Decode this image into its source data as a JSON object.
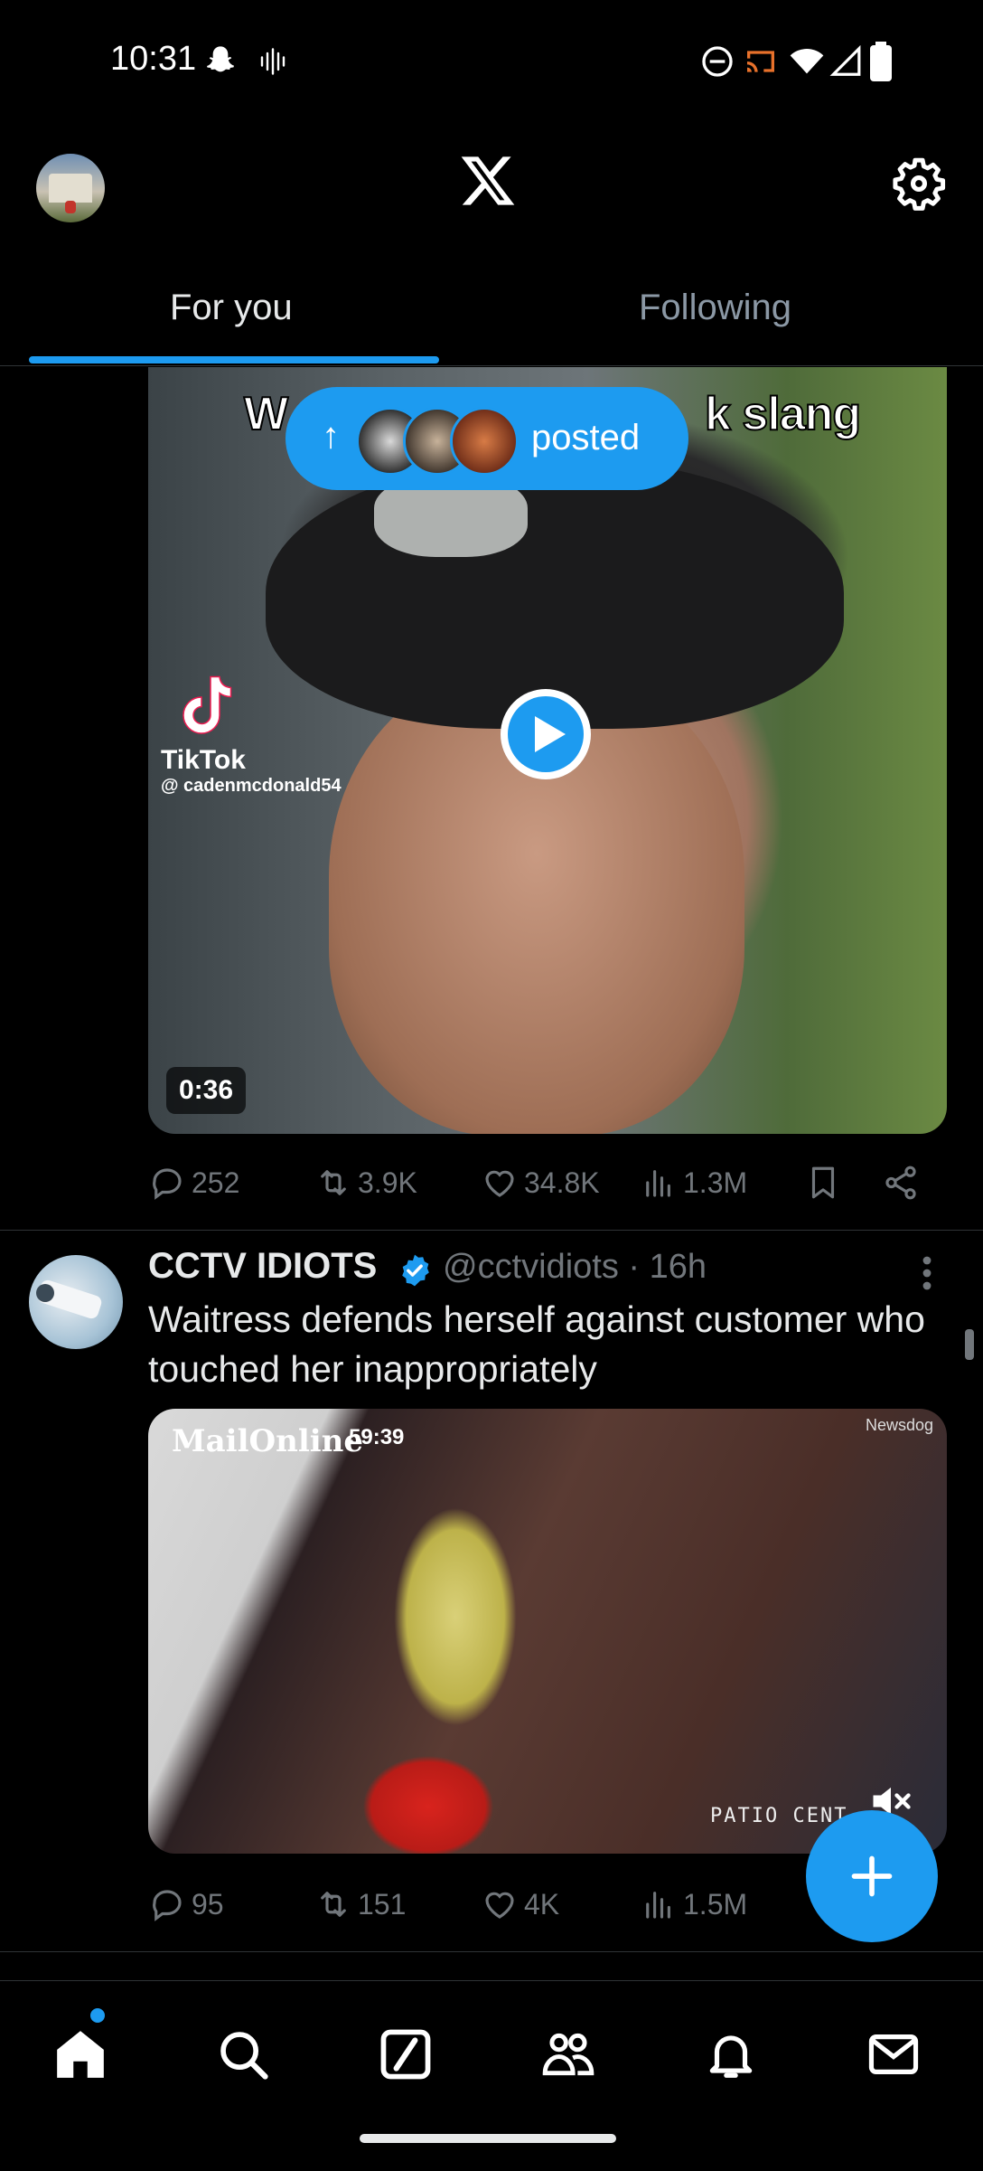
{
  "status_bar": {
    "time": "10:31",
    "icons": [
      "snapchat-icon",
      "voicemail-icon",
      "dnd-icon",
      "cast-icon",
      "wifi-icon",
      "signal-icon",
      "battery-icon"
    ]
  },
  "header": {
    "logo": "x-logo-icon",
    "settings": "gear-icon"
  },
  "tabs": [
    {
      "label": "For you",
      "active": true
    },
    {
      "label": "Following",
      "active": false
    }
  ],
  "posted_pill": {
    "label": "posted"
  },
  "tweet1": {
    "media": {
      "overlay_left": "W",
      "overlay_right": "k slang",
      "tiktok_label": "TikTok",
      "tiktok_handle": "@ cadenmcdonald54",
      "duration": "0:36"
    },
    "actions": {
      "replies": "252",
      "reposts": "3.9K",
      "likes": "34.8K",
      "views": "1.3M"
    }
  },
  "tweet2": {
    "name": "CCTV IDIOTS",
    "handle": "@cctvidiots · 16h",
    "text": "Waitress defends herself against customer who touched her inappropriately",
    "media": {
      "logo": "MailOnline",
      "time": "59:39",
      "source": "Newsdog",
      "caption": "PATIO CENT"
    },
    "actions": {
      "replies": "95",
      "reposts": "151",
      "likes": "4K",
      "views": "1.5M"
    }
  },
  "colors": {
    "accent": "#1d9bf0",
    "muted": "#71767b",
    "text": "#e7e9ea",
    "background": "#000000"
  }
}
